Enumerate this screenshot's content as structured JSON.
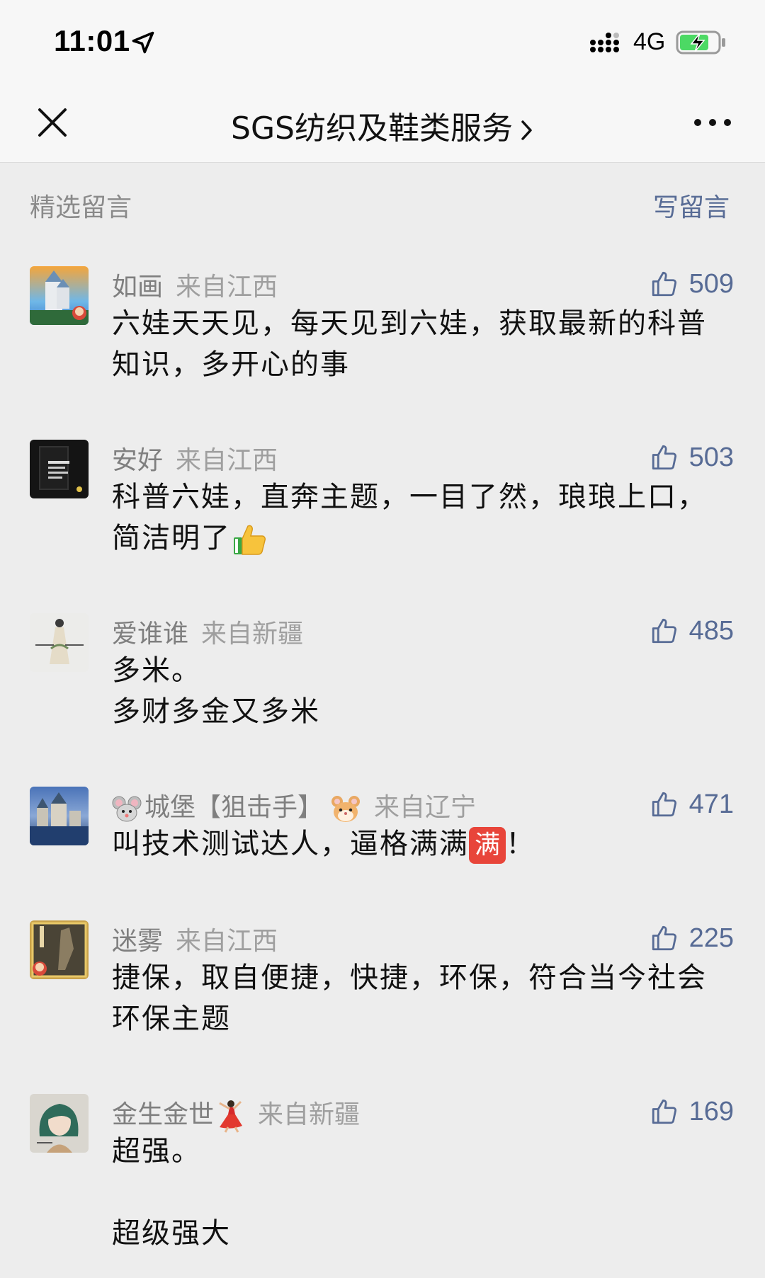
{
  "status_bar": {
    "time": "11:01",
    "network": "4G",
    "icons": [
      "location-arrow-icon",
      "cellular-signal-icon",
      "battery-charging-icon"
    ]
  },
  "nav": {
    "title": "SGS纺织及鞋类服务",
    "icons": [
      "close-icon",
      "chevron-right-icon",
      "more-icon"
    ]
  },
  "section": {
    "title": "精选留言",
    "write_label": "写留言"
  },
  "colors": {
    "background": "#ededed",
    "bar": "#f7f7f7",
    "link_blue": "#576b95",
    "meta_gray": "#8a8a8a"
  },
  "comments": [
    {
      "nickname": "如画",
      "region": "来自江西",
      "likes": "509",
      "lines": [
        "六娃天天见，每天见到六娃，获取最新的科普",
        "知识，多开心的事"
      ]
    },
    {
      "nickname": "安好",
      "region": "来自江西",
      "likes": "503",
      "lines": [
        "科普六娃，直奔主题，一目了然，琅琅上口，",
        "简洁明了"
      ],
      "emoji": "thumbs-up-icon"
    },
    {
      "nickname": "爱谁谁",
      "region": "来自新疆",
      "likes": "485",
      "lines": [
        "多米。",
        "多财多金又多米"
      ]
    },
    {
      "nickname": "城堡【狙击手】",
      "region": "来自辽宁",
      "likes": "471",
      "lines": [
        "叫技术测试达人，逼格满满",
        "！"
      ],
      "emoji": "full-badge-icon",
      "emoji_text": "满"
    },
    {
      "nickname": "迷雾",
      "region": "来自江西",
      "likes": "225",
      "lines": [
        "捷保，取自便捷，快捷，环保，符合当今社会",
        "环保主题"
      ]
    },
    {
      "nickname": "金生金世",
      "region": "来自新疆",
      "likes": "169",
      "lines": [
        "超强。",
        "",
        "超级强大"
      ],
      "emoji": "dancer-icon"
    }
  ]
}
